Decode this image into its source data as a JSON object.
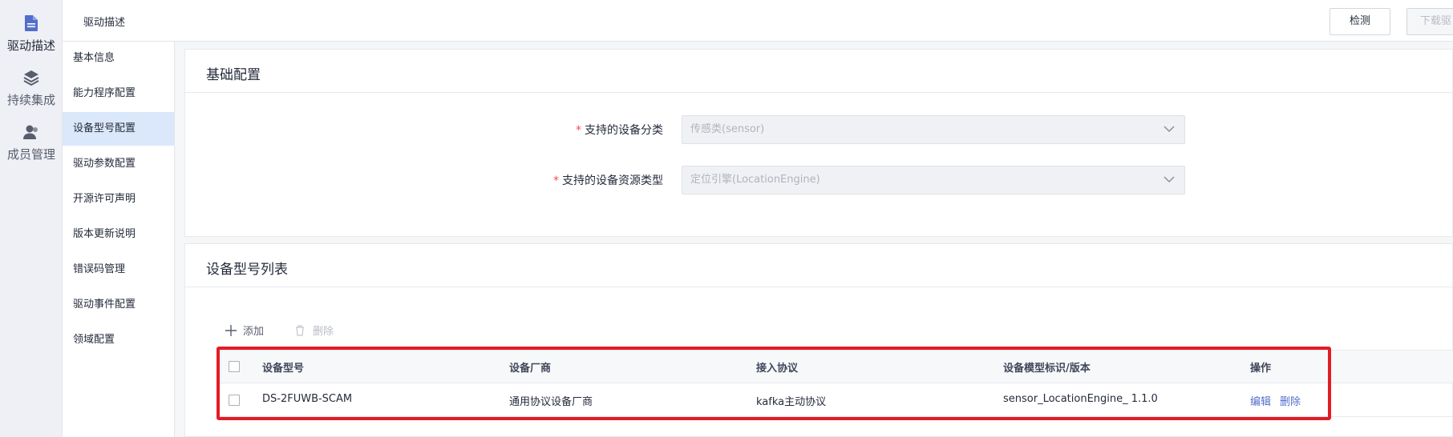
{
  "leftbar": {
    "items": [
      {
        "label": "驱动描述",
        "icon": "document-icon"
      },
      {
        "label": "持续集成",
        "icon": "layers-icon"
      },
      {
        "label": "成员管理",
        "icon": "user-icon"
      }
    ]
  },
  "topbar": {
    "title": "驱动描述",
    "detect_label": "检测",
    "download_label": "下载驱"
  },
  "nav": {
    "items": [
      "基本信息",
      "能力程序配置",
      "设备型号配置",
      "驱动参数配置",
      "开源许可声明",
      "版本更新说明",
      "错误码管理",
      "驱动事件配置",
      "领域配置"
    ],
    "active_index": 2
  },
  "basic_config": {
    "title": "基础配置",
    "fields": [
      {
        "label": "支持的设备分类",
        "value": "传感类(sensor)"
      },
      {
        "label": "支持的设备资源类型",
        "value": "定位引擎(LocationEngine)"
      }
    ]
  },
  "model_list": {
    "title": "设备型号列表",
    "add_label": "添加",
    "delete_label": "删除",
    "columns": [
      "设备型号",
      "设备厂商",
      "接入协议",
      "设备模型标识/版本",
      "操作"
    ],
    "rows": [
      {
        "model": "DS-2FUWB-SCAM",
        "vendor": "通用协议设备厂商",
        "protocol": "kafka主动协议",
        "model_id": "sensor_LocationEngine_ 1.1.0",
        "edit_label": "编辑",
        "delete_label": "删除"
      }
    ]
  },
  "colors": {
    "accent": "#526ecc",
    "required": "#f34b4b",
    "highlight_box": "#e21c24",
    "nav_active": "#dbe8fb"
  }
}
